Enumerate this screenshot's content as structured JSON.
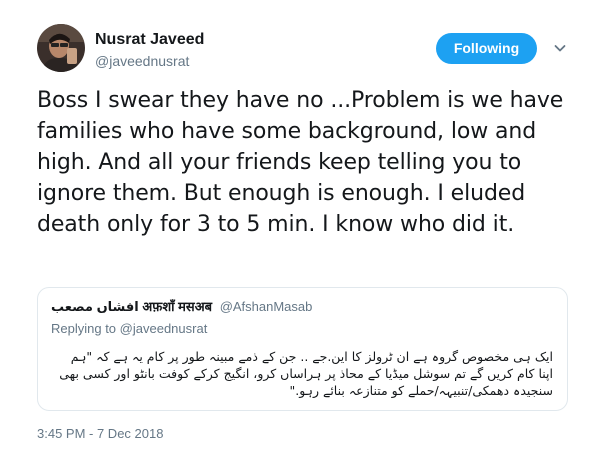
{
  "tweet": {
    "author_name": "Nusrat Javeed",
    "author_handle": "@javeednusrat",
    "follow_label": "Following",
    "text": "Boss I swear they have no ...Problem is we have families who have some background, low and high. And all your friends keep telling you to ignore them. But enough is enough. I eluded death only for 3 to 5 min. I know who did it.",
    "timestamp": "3:45 PM - 7 Dec 2018"
  },
  "quote": {
    "name": "افشاں مصعب अफ़शाँ मसअब",
    "handle": "@AfshanMasab",
    "replying_prefix": "Replying to",
    "replying_handle": "@javeednusrat",
    "text": "ایک ہی مخصوص گروہ ہے ان ٹرولز کا این.جے .. جن کے ذمے مبینہ طور پر کام یہ ہے کہ  \"ہم اپنا کام کریں گے تم سوشل میڈیا کے محاذ پر ہراساں کرو، انگیج کرکے کوفت بانٹو اور کسی بھی سنجیدہ دھمکی/تنبیہہ/حملے کو متنازعہ بنائے رہو.\""
  },
  "icons": {
    "avatar": "avatar-photo",
    "caret": "chevron-down-icon"
  },
  "colors": {
    "accent": "#1da1f2",
    "secondary_text": "#657786",
    "border": "#e1e8ed"
  }
}
